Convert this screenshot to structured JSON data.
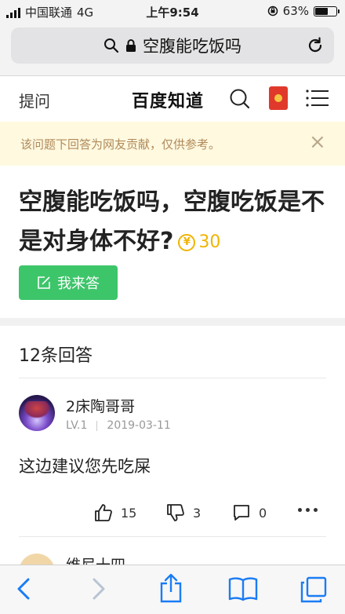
{
  "status_bar": {
    "carrier": "中国联通",
    "network": "4G",
    "time": "上午9:54",
    "battery_percent": "63%",
    "battery_level": 0.63
  },
  "url_bar": {
    "title": "空腹能吃饭吗"
  },
  "top_nav": {
    "ask_label": "提问",
    "brand": "百度知道"
  },
  "notice": {
    "text": "该问题下回答为网友贡献，仅供参考。",
    "close_symbol": "×"
  },
  "question": {
    "title": "空腹能吃饭吗，空腹吃饭是不是对身体不好?",
    "reward": "30",
    "answer_button_label": "我来答"
  },
  "answers": {
    "count_label": "12条回答",
    "items": [
      {
        "user": "2床陶哥哥",
        "level": "LV.1",
        "date": "2019-03-11",
        "content": "这边建议您先吃屎",
        "likes": "15",
        "dislikes": "3",
        "comments": "0"
      },
      {
        "user": "维尼十四"
      }
    ]
  },
  "colors": {
    "accent_green": "#3dc56a",
    "reward_gold": "#f0b400",
    "notice_bg": "#fff9e0",
    "notice_text": "#b08a5a",
    "ios_blue": "#1a7cf5"
  }
}
